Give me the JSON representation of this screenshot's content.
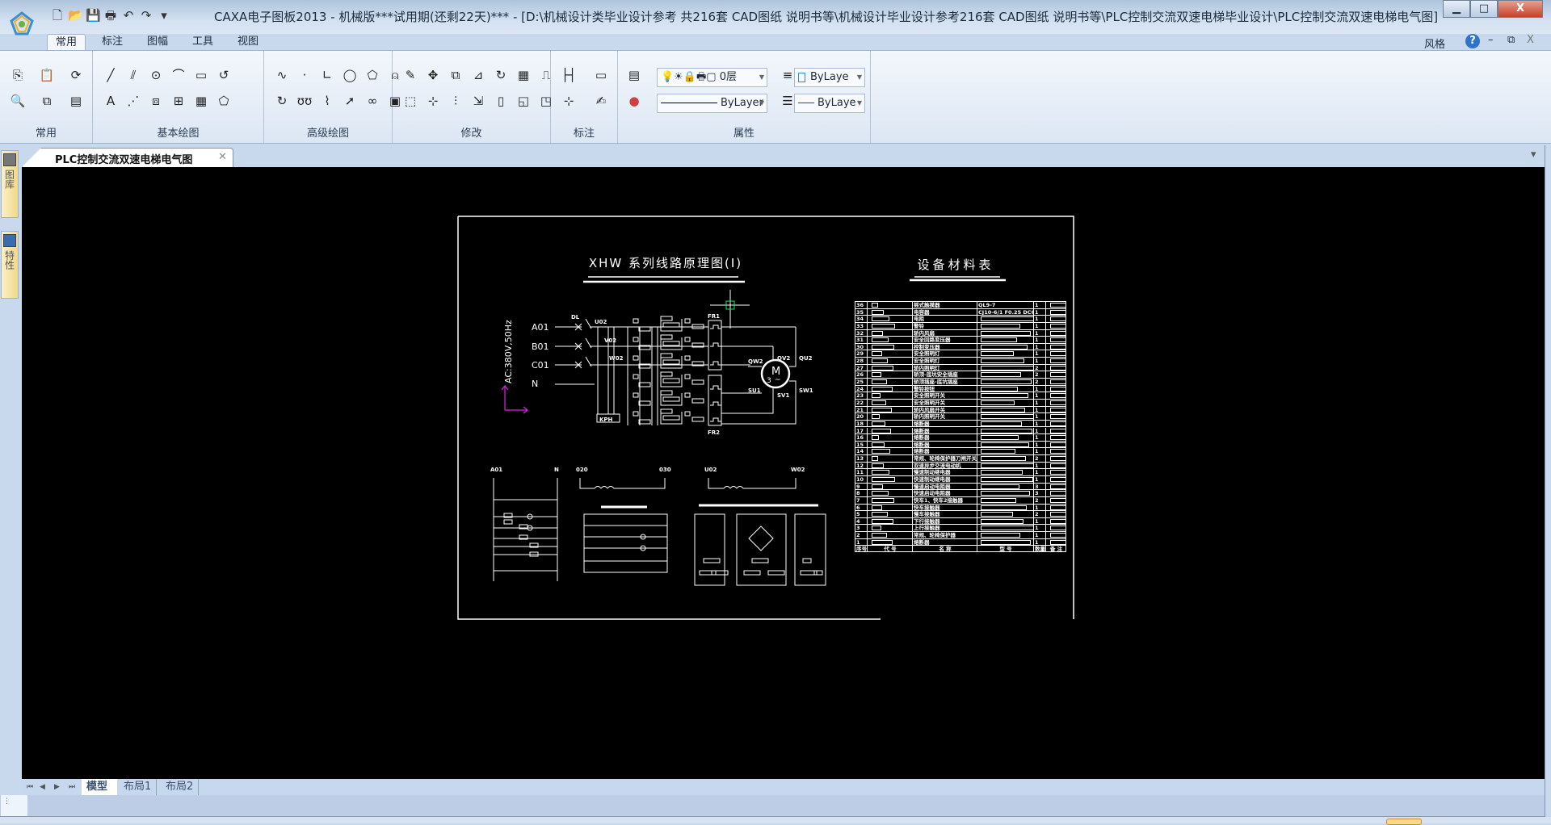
{
  "window": {
    "title": "CAXA电子图板2013 - 机械版***试用期(还剩22天)*** - [D:\\机械设计类毕业设计参考 共216套 CAD图纸 说明书等\\机械设计毕业设计参考216套 CAD图纸 说明书等\\PLC控制交流双速电梯毕业设计\\PLC控制交流双速电梯电气图]",
    "minimize": "▁",
    "maximize": "□",
    "close": "X"
  },
  "quick_access": [
    {
      "name": "new-file-icon",
      "glyph": "🗋"
    },
    {
      "name": "open-file-icon",
      "glyph": "📂"
    },
    {
      "name": "save-icon",
      "glyph": "💾"
    },
    {
      "name": "print-icon",
      "glyph": "🖶"
    },
    {
      "name": "undo-icon",
      "glyph": "↶"
    },
    {
      "name": "redo-icon",
      "glyph": "↷"
    },
    {
      "name": "customize-icon",
      "glyph": "▾"
    }
  ],
  "ribbon": {
    "tabs": [
      "常用",
      "标注",
      "图幅",
      "工具",
      "视图"
    ],
    "style_label": "风格",
    "groups": [
      {
        "label": "常用",
        "icons": [
          [
            "copy-icon",
            "⎘"
          ],
          [
            "paste-icon",
            "📋"
          ],
          [
            "refresh-icon",
            "⟳"
          ],
          [
            "zoom-icon",
            "🔍"
          ],
          [
            "clone-icon",
            "⧉"
          ],
          [
            "properties-icon",
            "▤"
          ]
        ]
      },
      {
        "label": "基本绘图",
        "icons": [
          [
            "line-icon",
            "╱"
          ],
          [
            "parallel-icon",
            "⫽"
          ],
          [
            "circle-icon",
            "⊙"
          ],
          [
            "arc-icon",
            "⌒"
          ],
          [
            "rectangle-icon",
            "▭"
          ],
          [
            "polyline-icon",
            "↺"
          ],
          [
            "text-icon",
            "A"
          ],
          [
            "centerline-icon",
            "⋰"
          ],
          [
            "hatch-block-icon",
            "⧈"
          ],
          [
            "insert-icon",
            "⊞"
          ],
          [
            "fill-icon",
            "▦"
          ],
          [
            "region-icon",
            "⬠"
          ]
        ]
      },
      {
        "label": "高级绘图",
        "icons": [
          [
            "spline-icon",
            "∿"
          ],
          [
            "point-icon",
            "·"
          ],
          [
            "angle-line-icon",
            "∟"
          ],
          [
            "ellipse-icon",
            "◯"
          ],
          [
            "polygon-icon",
            "⬠"
          ],
          [
            "hole-icon",
            "⍝"
          ],
          [
            "spiral-icon",
            "↻"
          ],
          [
            "wave-icon",
            "ʊʊ"
          ],
          [
            "break-line-icon",
            "⌇"
          ],
          [
            "arrow-icon",
            "➚"
          ],
          [
            "chain-icon",
            "∞"
          ],
          [
            "gear-icon",
            "▣"
          ]
        ]
      },
      {
        "label": "修改",
        "icons": [
          [
            "erase-icon",
            "✎"
          ],
          [
            "move-icon",
            "✥"
          ],
          [
            "copy-object-icon",
            "⧉"
          ],
          [
            "mirror-icon",
            "⊿"
          ],
          [
            "rotate-icon",
            "↻"
          ],
          [
            "array-icon",
            "▦"
          ],
          [
            "offset-icon",
            "⎍"
          ],
          [
            "trim-icon",
            "⬚"
          ],
          [
            "extend-icon",
            "⊹"
          ],
          [
            "break-icon",
            "⫶"
          ],
          [
            "stretch-icon",
            "⇲"
          ],
          [
            "scale-icon",
            "▯"
          ],
          [
            "chamfer-icon",
            "◱"
          ],
          [
            "fillet-icon",
            "◳"
          ]
        ]
      },
      {
        "label": "标注",
        "icons": [
          [
            "dimension-icon",
            "├┤"
          ],
          [
            "text-annotation-icon",
            "▭"
          ],
          [
            "coordinate-icon",
            "⊹"
          ],
          [
            "edit-annotation-icon",
            "✍"
          ]
        ]
      },
      {
        "label": "属性",
        "icons": [
          [
            "layer-manager-icon",
            "▤"
          ],
          [
            "linewidth-icon",
            "≡"
          ],
          [
            "color-icon",
            "●"
          ],
          [
            "linetype-icon",
            "☰"
          ]
        ]
      }
    ],
    "layer_combo": "💡☀🔒🖶▢ 0层",
    "linetype_combo": "ByLayer",
    "color_combo": "ByLaye",
    "linewidth_combo": "ByLaye"
  },
  "document": {
    "tab_label": "PLC控制交流双速电梯电气图",
    "close": "✕",
    "list_arrow": "▾"
  },
  "side_panels": [
    {
      "label": "图库",
      "icon": "library-icon"
    },
    {
      "label": "特性",
      "icon": "properties-icon"
    }
  ],
  "layout_tabs": {
    "nav": [
      "⏮",
      "◀",
      "▶",
      "⏭"
    ],
    "tabs": [
      "模型",
      "布局1",
      "布局2"
    ],
    "active": 0
  },
  "drawing": {
    "title": "XHW 系列线路原理图(I)",
    "supply": "AC:380V,50Hz",
    "phases": [
      "A01",
      "B01",
      "C01",
      "N"
    ],
    "breaker": "DL",
    "nodes": [
      "U02",
      "V02",
      "W02"
    ],
    "relay_top": "FR1",
    "relay_bottom": "FR2",
    "motor": "M",
    "motor_phase": "3",
    "motor_ac": "~",
    "terminals": [
      "QW2",
      "QV2",
      "QU2",
      "SU1",
      "SV1",
      "SW1"
    ],
    "kph": "KPH",
    "sub1": [
      "A01",
      "N"
    ],
    "sub2": [
      "020",
      "030"
    ],
    "sub3": [
      "U02",
      "W02"
    ],
    "materials": {
      "title": "设备材料表",
      "header": [
        "序号",
        "代 号",
        "名 称",
        "型 号",
        "数量",
        "备 注"
      ],
      "rows": [
        [
          "36",
          "摇式触摸器",
          "QL9-7",
          "1"
        ],
        [
          "35",
          "电容器",
          "CJ10-6/1 F0.25 DC600V",
          "1"
        ],
        [
          "34",
          "电阻",
          "",
          "1"
        ],
        [
          "33",
          "警铃",
          "",
          "1"
        ],
        [
          "32",
          "轿内风扇",
          "",
          "1"
        ],
        [
          "31",
          "安全回路变压器",
          "",
          "1"
        ],
        [
          "30",
          "控制变压器",
          "",
          "1"
        ],
        [
          "29",
          "安全照明灯",
          "",
          "1"
        ],
        [
          "28",
          "安全照明灯",
          "",
          "1"
        ],
        [
          "27",
          "轿内照明灯",
          "",
          "2"
        ],
        [
          "26",
          "轿顶-底坑安全插座",
          "",
          "2"
        ],
        [
          "25",
          "轿顶插座-底坑插座",
          "",
          "2"
        ],
        [
          "24",
          "警铃按钮",
          "",
          "1"
        ],
        [
          "23",
          "安全照明开关",
          "",
          "1"
        ],
        [
          "22",
          "安全照明开关",
          "",
          "1"
        ],
        [
          "21",
          "轿内风扇开关",
          "",
          "1"
        ],
        [
          "20",
          "轿内照明开关",
          "",
          "1"
        ],
        [
          "18",
          "熔断器",
          "",
          "1"
        ],
        [
          "17",
          "熔断器",
          "",
          "1"
        ],
        [
          "16",
          "熔断器",
          "",
          "1"
        ],
        [
          "15",
          "熔断器",
          "",
          "1"
        ],
        [
          "14",
          "熔断器",
          "",
          "1"
        ],
        [
          "13",
          "常规、轮椅保护器刀闸开关",
          "",
          "2"
        ],
        [
          "12",
          "双速异步交流电动机",
          "",
          "1"
        ],
        [
          "11",
          "慢速制动继电器",
          "",
          "1"
        ],
        [
          "10",
          "快速制动继电器",
          "",
          "1"
        ],
        [
          "9",
          "慢速启动电阻器",
          "",
          "3"
        ],
        [
          "8",
          "快速启动电阻器",
          "",
          "3"
        ],
        [
          "7",
          "快车1、快车2接触器",
          "",
          "2"
        ],
        [
          "6",
          "快车接触器",
          "",
          "1"
        ],
        [
          "5",
          "慢车接触器",
          "",
          "2"
        ],
        [
          "4",
          "下行接触器",
          "",
          "1"
        ],
        [
          "3",
          "上行接触器",
          "",
          "1"
        ],
        [
          "2",
          "常规、轮椅保护器",
          "",
          "1"
        ],
        [
          "1",
          "熔断器",
          "",
          "1"
        ]
      ]
    }
  }
}
